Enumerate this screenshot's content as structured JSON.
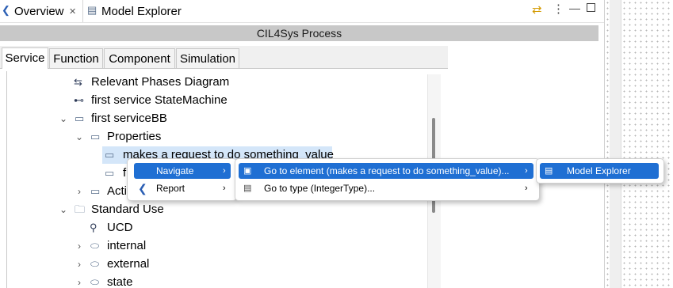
{
  "tabs": {
    "overview_label": "Overview",
    "model_explorer_label": "Model Explorer",
    "overview_close": "✕"
  },
  "process": {
    "title": "CIL4Sys Process"
  },
  "subtabs": [
    "Service",
    "Function",
    "Component",
    "Simulation"
  ],
  "tree": {
    "rows": [
      {
        "label": "Relevant Phases Diagram"
      },
      {
        "label": "first service StateMachine"
      },
      {
        "label": "first serviceBB"
      },
      {
        "label": "Properties"
      },
      {
        "label": "makes a request to do something_value"
      },
      {
        "label": "f"
      },
      {
        "label": "Acti"
      },
      {
        "label": "Standard Use"
      },
      {
        "label": "UCD"
      },
      {
        "label": "internal"
      },
      {
        "label": "external"
      },
      {
        "label": "state"
      }
    ]
  },
  "context_menu": {
    "items": [
      {
        "label": "Navigate"
      },
      {
        "label": "Report"
      }
    ]
  },
  "navigate_submenu": {
    "items": [
      {
        "label": "Go to element (makes a request to do something_value)..."
      },
      {
        "label": "Go to type (IntegerType)..."
      }
    ]
  },
  "goto_submenu": {
    "items": [
      {
        "label": "Model Explorer"
      }
    ]
  },
  "colors": {
    "menu_highlight": "#1f6fd3",
    "process_bar": "#c8c8c8",
    "selection": "#d4e6f9"
  }
}
